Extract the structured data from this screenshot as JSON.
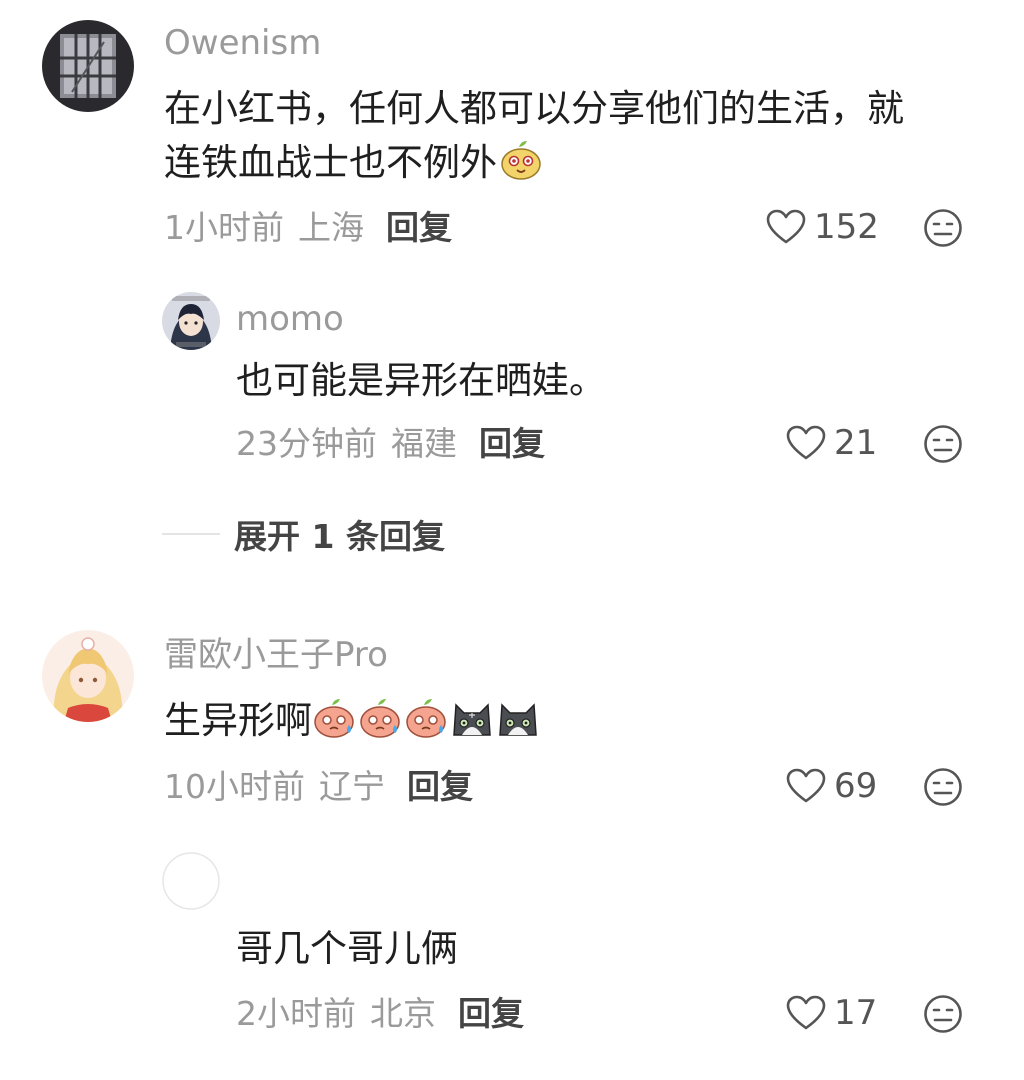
{
  "comments": [
    {
      "username": "Owenism",
      "text_line1": "在小红书，任何人都可以分享他们的生活，就",
      "text_line2": "连铁血战士也不例外",
      "time": "1小时前",
      "location": "上海",
      "reply_label": "回复",
      "likes": "152",
      "emojis": [
        "pear-face"
      ]
    },
    {
      "username": "momo",
      "text": "也可能是异形在晒娃。",
      "time": "23分钟前",
      "location": "福建",
      "reply_label": "回复",
      "likes": "21"
    },
    {
      "username": "雷欧小王子Pro",
      "text": "生异形啊",
      "time": "10小时前",
      "location": "辽宁",
      "reply_label": "回复",
      "likes": "69",
      "emojis": [
        "sweat-peach-face",
        "sweat-peach-face",
        "sweat-peach-face",
        "gray-cat-face",
        "gray-cat-face"
      ]
    },
    {
      "username": "",
      "text": "哥几个哥儿俩",
      "time": "2小时前",
      "location": "北京",
      "reply_label": "回复",
      "likes": "17"
    }
  ],
  "expand_replies_label": "展开 1 条回复",
  "icons": {
    "like": "heart-outline-icon",
    "reaction": "meh-face-icon"
  },
  "colors": {
    "text": "#1f1f1f",
    "muted": "#9a9a9a",
    "emphasis": "#444444"
  }
}
